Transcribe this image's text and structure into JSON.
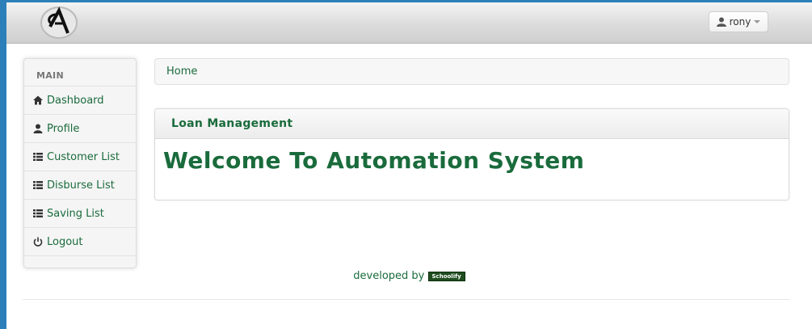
{
  "navbar": {
    "user_name": "rony"
  },
  "sidebar": {
    "header": "MAIN",
    "items": [
      {
        "label": "Dashboard",
        "icon": "home-icon"
      },
      {
        "label": "Profile",
        "icon": "user-icon"
      },
      {
        "label": "Customer List",
        "icon": "list-icon"
      },
      {
        "label": "Disburse List",
        "icon": "list-icon"
      },
      {
        "label": "Saving List",
        "icon": "list-icon"
      },
      {
        "label": "Logout",
        "icon": "power-icon"
      }
    ]
  },
  "breadcrumb": {
    "home": "Home"
  },
  "panel": {
    "title": "Loan Management",
    "welcome": "Welcome To Automation System"
  },
  "footer": {
    "developed_by": "developed by",
    "brand": "Schoolify"
  },
  "colors": {
    "accent_green": "#1a6b3c",
    "desktop_blue": "#2c7fb8"
  }
}
